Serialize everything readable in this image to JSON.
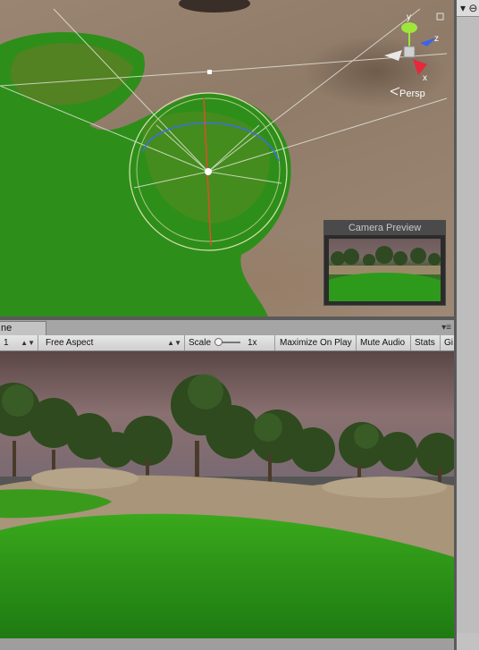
{
  "scene": {
    "gizmo": {
      "projection_label": "Persp",
      "axes": {
        "y": "y",
        "z": "z",
        "x": "x"
      }
    },
    "camera_preview": {
      "title": "Camera Preview"
    }
  },
  "game": {
    "tab_label": "ne",
    "toolbar": {
      "display_value": "1",
      "aspect_value": "Free Aspect",
      "scale_label": "Scale",
      "scale_value": "1x",
      "maximize_label": "Maximize On Play",
      "mute_label": "Mute Audio",
      "stats_label": "Stats",
      "gizmos_label": "Gi"
    }
  },
  "colors": {
    "selection_ring": "#c8d8a0",
    "gizmo_y": "#9ee63c",
    "gizmo_z": "#3c64e6",
    "gizmo_x": "#e6283c",
    "grass": "#2e9a1c",
    "ground": "#9a8572"
  }
}
